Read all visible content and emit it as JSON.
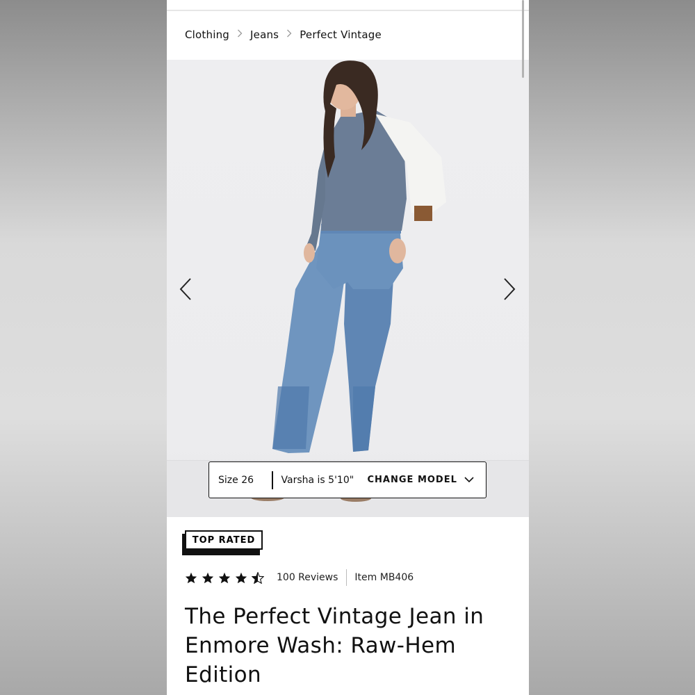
{
  "breadcrumb": [
    "Clothing",
    "Jeans",
    "Perfect Vintage"
  ],
  "hero": {
    "prev_icon": "chevron-left-icon",
    "next_icon": "chevron-right-icon"
  },
  "model_bar": {
    "size": "Size 26",
    "height": "Varsha is 5'10\"",
    "change_label": "CHANGE MODEL",
    "dropdown_icon": "chevron-down-icon"
  },
  "badge": "TOP RATED",
  "rating": {
    "stars": 4.5,
    "reviews": "100 Reviews",
    "item": "Item MB406"
  },
  "product": {
    "title": "The Perfect Vintage Jean in Enmore Wash: Raw-Hem Edition"
  }
}
